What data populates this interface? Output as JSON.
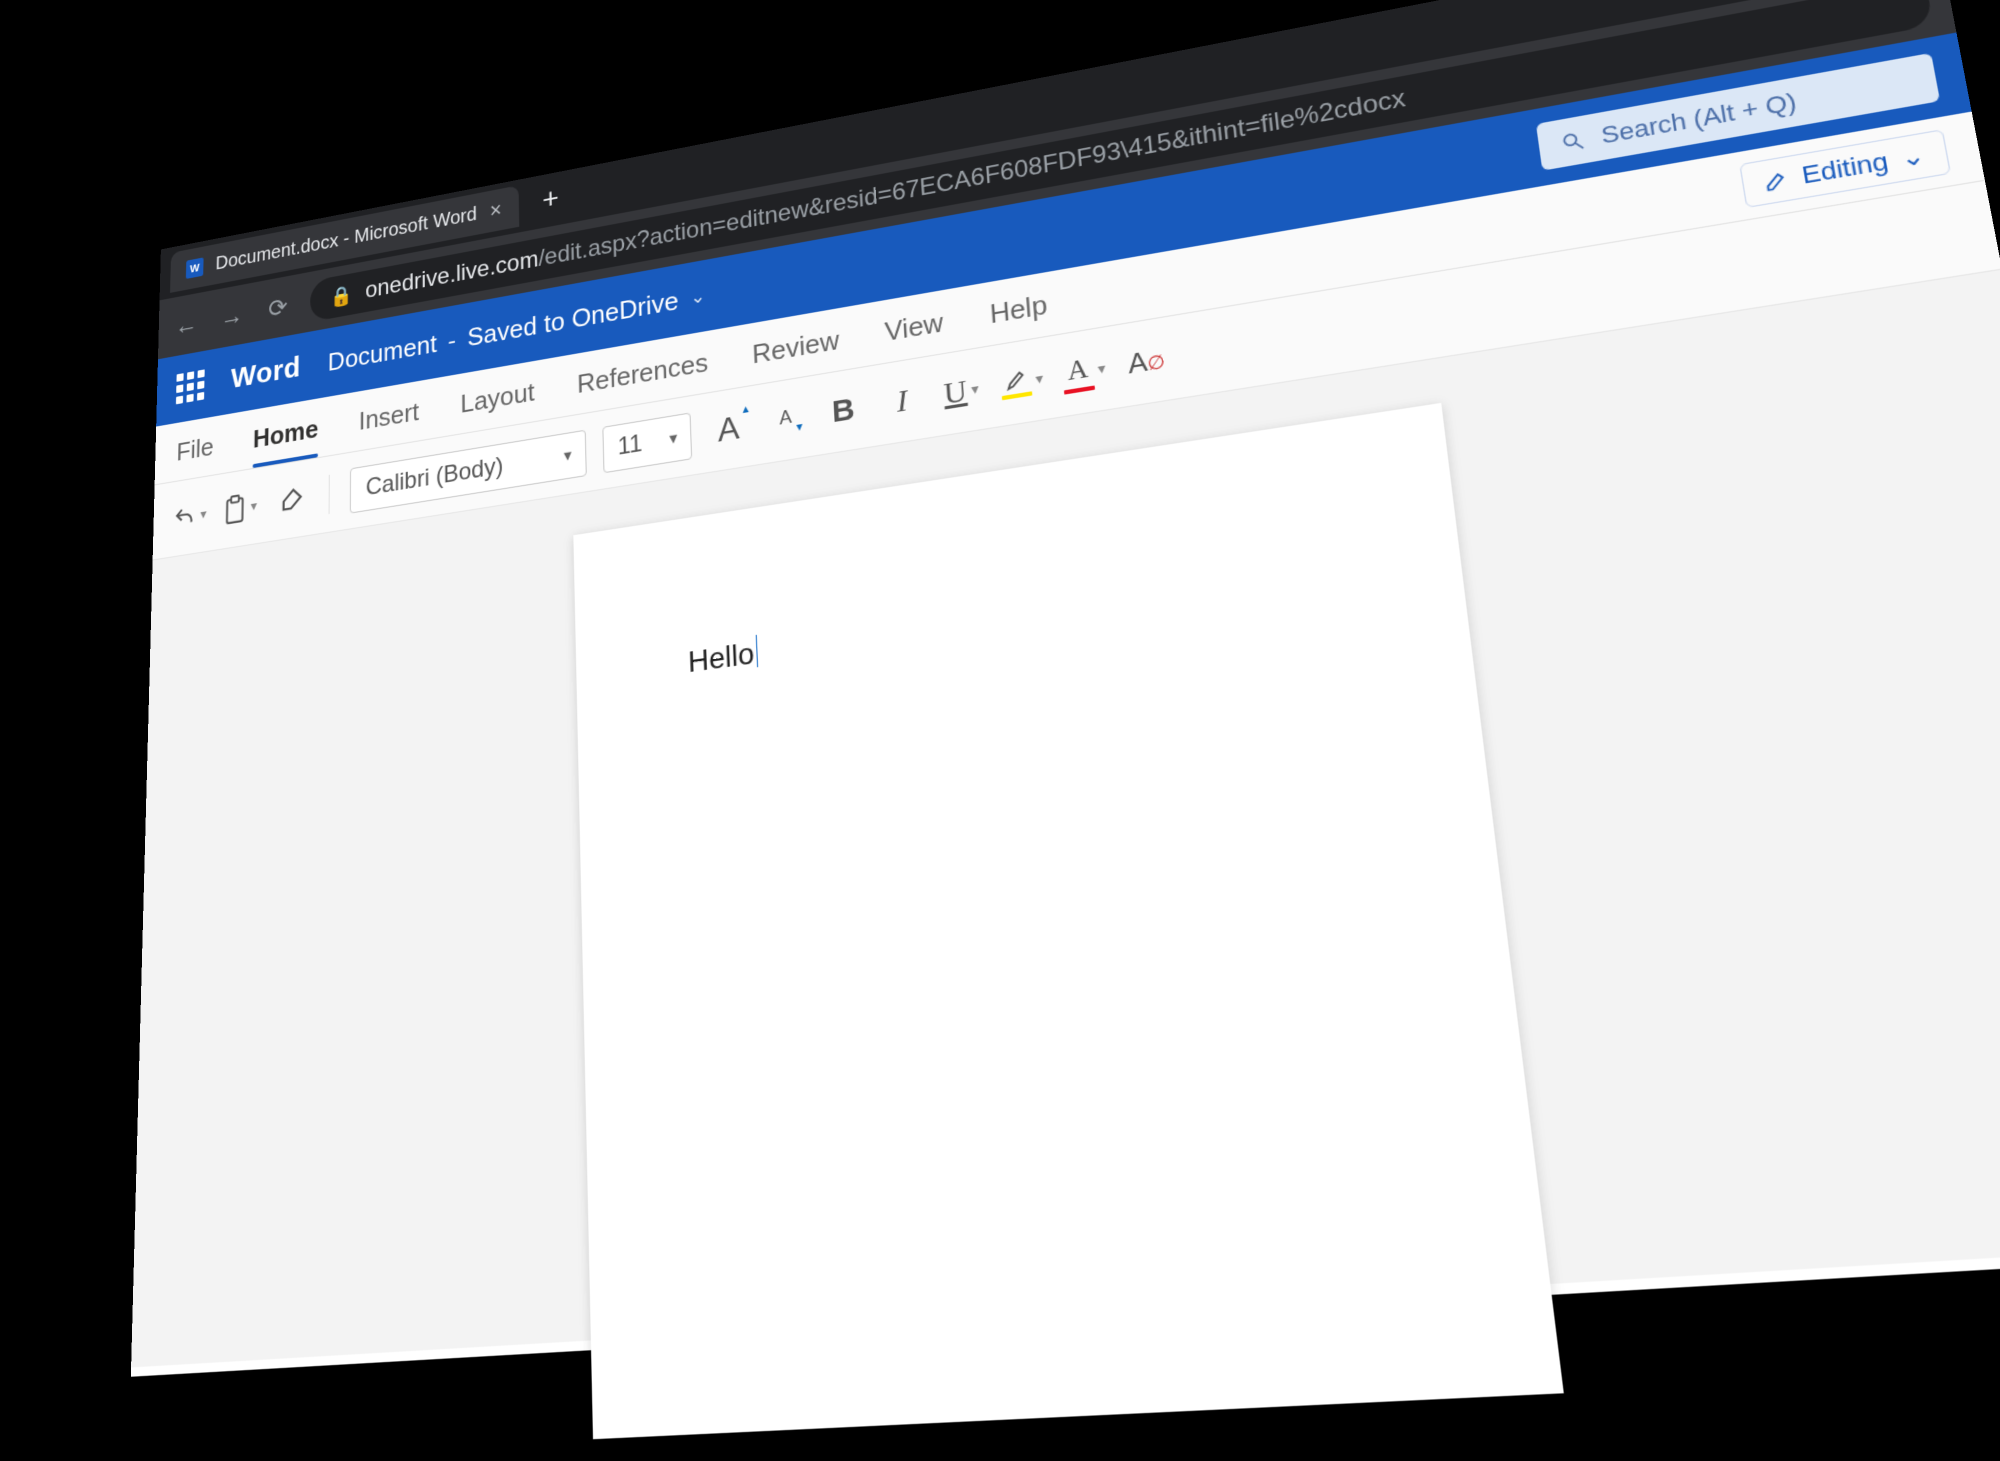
{
  "browser": {
    "tab": {
      "title": "Document.docx - Microsoft Word"
    },
    "url_host": "onedrive.live.com",
    "url_path": "/edit.aspx?action=editnew&resid=67ECA6F608FDF93\\415&ithint=file%2cdocx"
  },
  "header": {
    "brand": "Word",
    "doc_name": "Document",
    "save_state": "Saved to OneDrive",
    "search_placeholder": "Search (Alt + Q)"
  },
  "ribbon": {
    "tabs": {
      "file": "File",
      "home": "Home",
      "insert": "Insert",
      "layout": "Layout",
      "references": "References",
      "review": "Review",
      "view": "View",
      "help": "Help"
    },
    "mode_label": "Editing",
    "font_name": "Calibri (Body)",
    "font_size": "11"
  },
  "document": {
    "body_text": "Hello"
  }
}
